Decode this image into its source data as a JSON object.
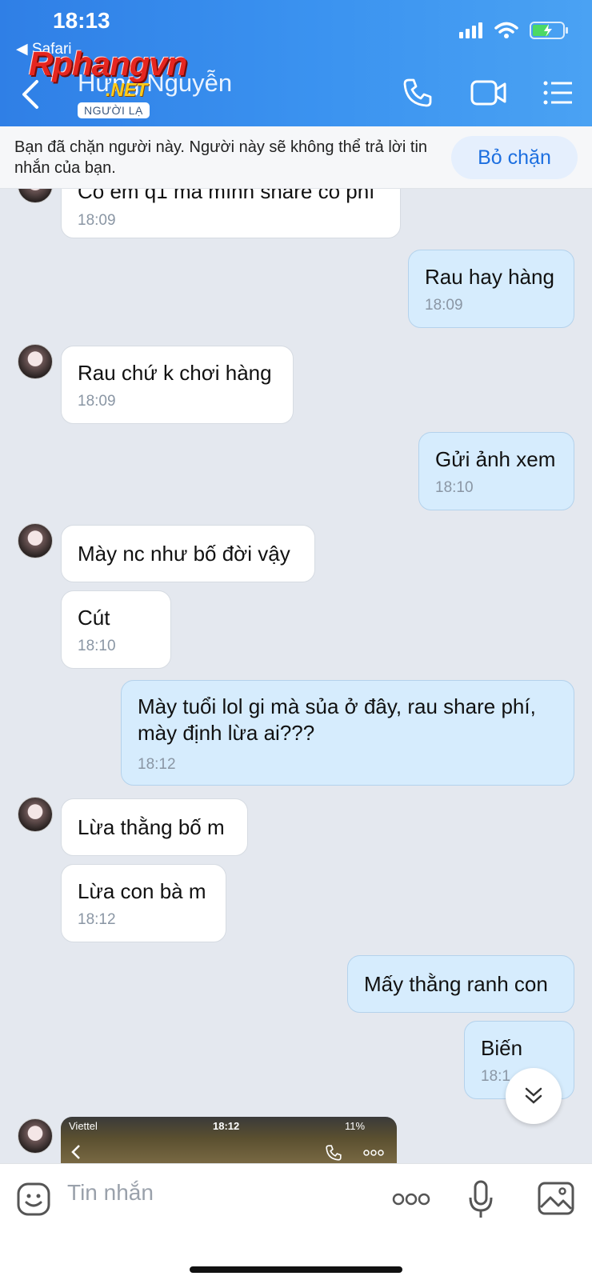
{
  "status_bar": {
    "time": "18:13",
    "back_app": "◀ Safari"
  },
  "watermark": {
    "main": "Rphangvn",
    "sub": ".NET"
  },
  "header": {
    "contact_name": "Hưng Nguyễn",
    "badge": "NGƯỜI LẠ"
  },
  "banner": {
    "text": "Bạn đã chặn người này. Người này sẽ không thể trả lời tin nhắn của bạn.",
    "unblock_label": "Bỏ chặn"
  },
  "messages": [
    {
      "dir": "in",
      "text": "Có em q1 mà mình share có phí",
      "time": "18:09"
    },
    {
      "dir": "out",
      "text": "Rau hay hàng",
      "time": "18:09"
    },
    {
      "dir": "in",
      "text": "Rau chứ k chơi hàng",
      "time": "18:09"
    },
    {
      "dir": "out",
      "text": "Gửi ảnh xem",
      "time": "18:10"
    },
    {
      "dir": "in",
      "text": "Mày nc như bố đời vậy",
      "time": ""
    },
    {
      "dir": "in",
      "text": "Cút",
      "time": "18:10"
    },
    {
      "dir": "out",
      "text": "Mày tuổi lol gi mà sủa ở đây, rau share phí, mày định lừa ai???",
      "time": "18:12"
    },
    {
      "dir": "in",
      "text": "Lừa thằng bố m",
      "time": ""
    },
    {
      "dir": "in",
      "text": "Lừa con bà m",
      "time": "18:12"
    },
    {
      "dir": "out",
      "text": "Mấy thằng ranh con",
      "time": ""
    },
    {
      "dir": "out",
      "text": "Biến",
      "time": "18:1"
    }
  ],
  "image_preview": {
    "carrier": "Viettel",
    "time": "18:12",
    "battery": "11%"
  },
  "composer": {
    "placeholder": "Tin nhắn"
  },
  "colors": {
    "header": "#3b8ef0",
    "outgoing_bubble": "#d6ecfd",
    "incoming_bubble": "#ffffff",
    "accent": "#1d6fe0"
  }
}
